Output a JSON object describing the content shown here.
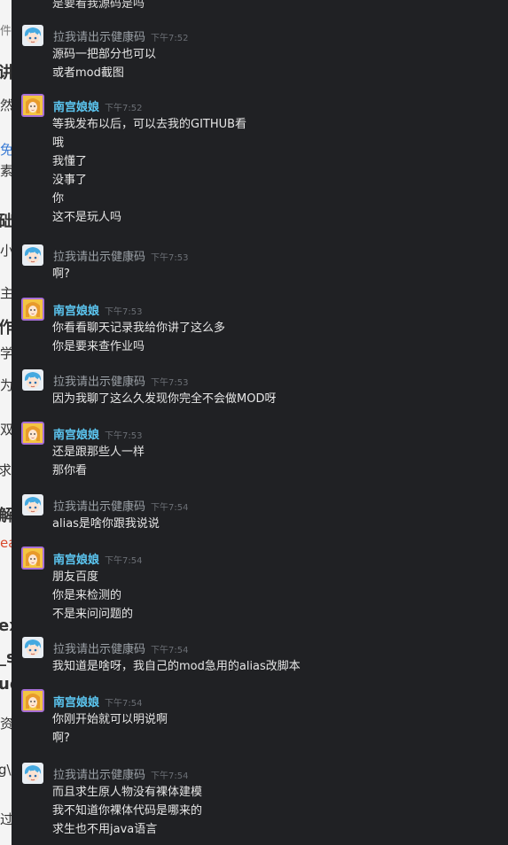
{
  "background_fragments": [
    "件",
    "讲",
    "然",
    "免",
    "素",
    "础",
    "小",
    "主",
    "作",
    "学",
    "为",
    "双",
    "求",
    "解",
    "ea",
    "ex",
    "_s",
    "ud",
    "资",
    "g\\",
    "过"
  ],
  "top_text": "是要看我源码是吗",
  "users": {
    "friend": "拉我请出示健康码",
    "me": "南宫娘娘"
  },
  "messages": [
    {
      "user": "friend",
      "time": "下午7:52",
      "lines": [
        "源码一把部分也可以",
        "或者mod截图"
      ]
    },
    {
      "user": "me",
      "time": "下午7:52",
      "lines": [
        "等我发布以后，可以去我的GITHUB看",
        "哦",
        "我懂了",
        "没事了",
        "你",
        "这不是玩人吗"
      ]
    },
    {
      "user": "friend",
      "time": "下午7:53",
      "lines": [
        "啊?"
      ]
    },
    {
      "user": "me",
      "time": "下午7:53",
      "lines": [
        "你看看聊天记录我给你讲了这么多",
        "你是要来查作业吗"
      ]
    },
    {
      "user": "friend",
      "time": "下午7:53",
      "lines": [
        "因为我聊了这么久发现你完全不会做MOD呀"
      ]
    },
    {
      "user": "me",
      "time": "下午7:53",
      "lines": [
        "还是跟那些人一样",
        "那你看"
      ]
    },
    {
      "user": "friend",
      "time": "下午7:54",
      "lines": [
        "alias是啥你跟我说说"
      ]
    },
    {
      "user": "me",
      "time": "下午7:54",
      "lines": [
        "朋友百度",
        "你是来检测的",
        "不是来问问题的"
      ]
    },
    {
      "user": "friend",
      "time": "下午7:54",
      "lines": [
        "我知道是啥呀，我自己的mod急用的alias改脚本"
      ]
    },
    {
      "user": "me",
      "time": "下午7:54",
      "lines": [
        "你刚开始就可以明说啊",
        "啊?"
      ]
    },
    {
      "user": "friend",
      "time": "下午7:54",
      "lines": [
        "而且求生原人物没有裸体建模",
        "我不知道你裸体代码是哪来的",
        "求生也不用java语言"
      ]
    }
  ],
  "colors": {
    "background": "#202124",
    "me_name": "#5cc7f2",
    "friend_name": "#9aa0a6",
    "timestamp": "#6b6f75",
    "text": "#e6e6e6"
  },
  "icons": {
    "friend_avatar": "cartoon-blue-hair-avatar",
    "me_avatar": "cartoon-girl-avatar"
  }
}
